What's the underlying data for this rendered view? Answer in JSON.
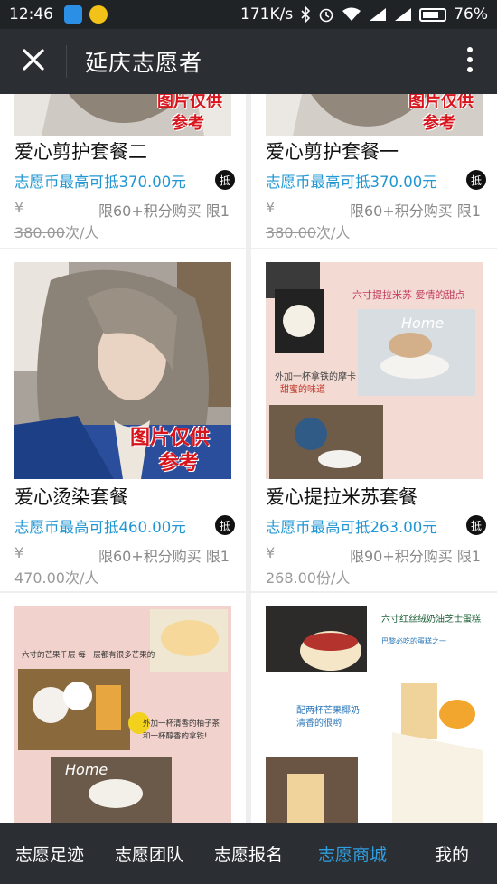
{
  "status_bar": {
    "time": "12:46",
    "speed": "171K/s",
    "battery": "76%",
    "battery_level": 0.76
  },
  "header": {
    "title": "延庆志愿者",
    "close_icon": "close-icon",
    "more_icon": "more-vertical-icon"
  },
  "stamp_text": {
    "line1": "图片仅供",
    "line2": "参考"
  },
  "overlay_texts": {
    "c4_line1": "六寸提拉米苏 爱情的甜点",
    "c4_line2": "外加一杯拿铁的摩卡",
    "c4_line3": "甜蜜的味道",
    "c4_home": "Home",
    "c5_line1": "六寸的芒果千层 每一层都有很多芒果的",
    "c5_line2": "外加一杯清香的柚子茶",
    "c5_line3": "和一杯醇香的拿铁!",
    "c5_home": "Home",
    "c6_line1": "六寸红丝绒奶油芝士蛋糕",
    "c6_line2": "配两杯芒果椰奶 清香的很哟",
    "c6_line3": "巴黎必吃的蛋糕之一"
  },
  "products": [
    {
      "name": "爱心剪护套餐二",
      "coin_text": "志愿币最高可抵370.00元",
      "badge": "抵",
      "yen": "¥",
      "limit": "限60+积分购买 限1",
      "old_price": "380.00",
      "unit": "次/人"
    },
    {
      "name": "爱心剪护套餐一",
      "coin_text": "志愿币最高可抵370.00元",
      "badge": "抵",
      "yen": "¥",
      "limit": "限60+积分购买 限1",
      "old_price": "380.00",
      "unit": "次/人"
    },
    {
      "name": "爱心烫染套餐",
      "coin_text": "志愿币最高可抵460.00元",
      "badge": "抵",
      "yen": "¥",
      "limit": "限60+积分购买 限1",
      "old_price": "470.00",
      "unit": "次/人"
    },
    {
      "name": "爱心提拉米苏套餐",
      "coin_text": "志愿币最高可抵263.00元",
      "badge": "抵",
      "yen": "¥",
      "limit": "限90+积分购买 限1",
      "old_price": "268.00",
      "unit": "份/人"
    }
  ],
  "bottom_nav": [
    {
      "label": "志愿足迹",
      "active": false
    },
    {
      "label": "志愿团队",
      "active": false
    },
    {
      "label": "志愿报名",
      "active": false
    },
    {
      "label": "志愿商城",
      "active": true
    },
    {
      "label": "我的",
      "active": false
    }
  ],
  "colors": {
    "accent": "#2196d3",
    "nav_active": "#2f9fe0",
    "header_bg": "#2b2f33",
    "stamp_red": "#d8141c"
  }
}
